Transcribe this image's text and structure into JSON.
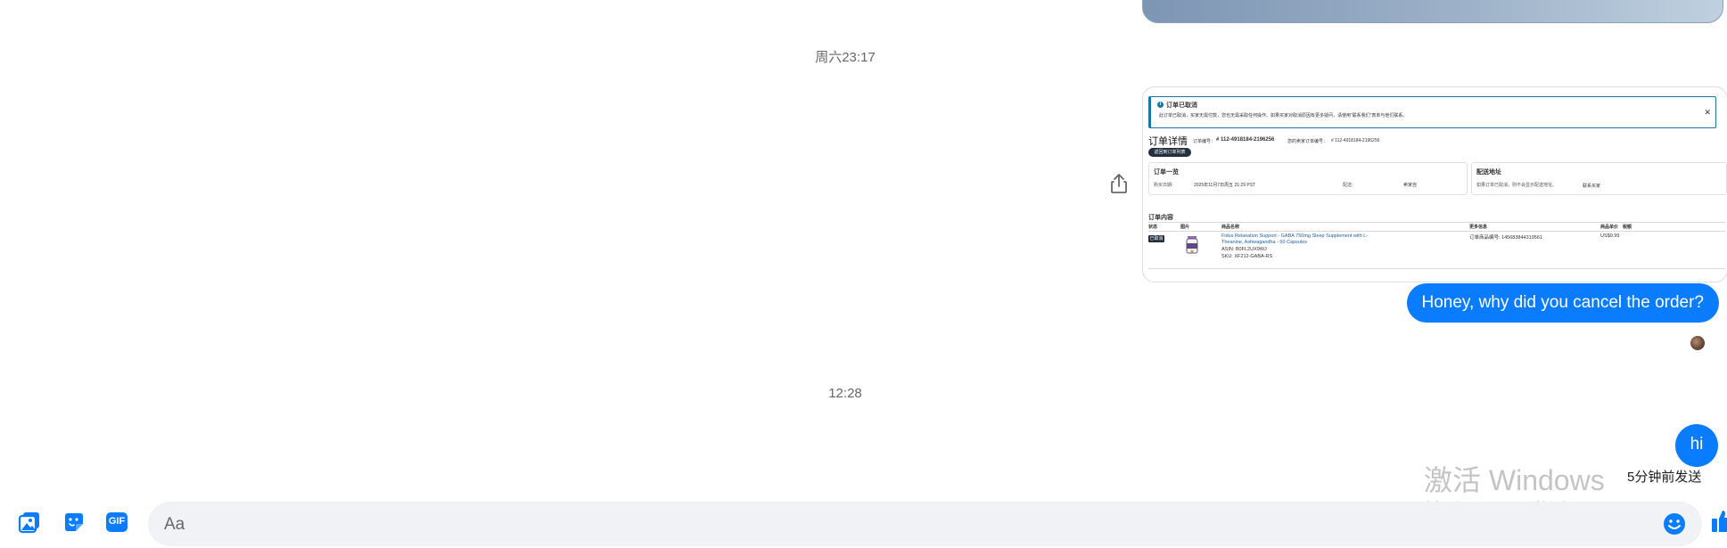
{
  "thread": {
    "timestamp_1": "周六23:17",
    "timestamp_2": "12:28"
  },
  "order_screenshot": {
    "alert_title": "订单已取消",
    "alert_body": "此订单已取消，买家无需付款，您也无需采取任何操作。如果买家对取消原因有更多疑问，请使用“联系我们”表单与他们联系。",
    "heading": "订单详情",
    "order_id_label": "订单编号：",
    "order_id": "# 112-4918184-2196256",
    "seller_order_label": "您的卖家订单编号：",
    "seller_order_id": "# 112-4918184-2196256",
    "back_button": "返回到订单列表",
    "summary_title": "订单一览",
    "ship_date_label": "购买日期:",
    "ship_date": "2025年11月7日周五 21:29 PST",
    "channel_label": "配送:",
    "channel": "卖家自",
    "address_title": "配送地址",
    "address_note": "如果订单已取消，则不会显示配送地址。",
    "address_link": "联系买家",
    "contents_title": "订单内容",
    "columns": [
      "状态",
      "图片",
      "商品名称",
      "更多信息",
      "商品单价",
      "税额"
    ],
    "row": {
      "status": "已取消",
      "product_line1": "Fidus Relaxation Support - GABA 750mg Sleep Supplement with L-",
      "product_line2": "Theanine, Ashwagandha - 60 Capsules",
      "asin": "ASIN: B0FL2UX9WJ",
      "sku": "SKU: XF212-GABA-RS",
      "more_info": "订单商品编号: 145683844319561",
      "unit_price": "US$9.99"
    }
  },
  "messages": {
    "question": "Honey, why did you cancel the order?",
    "hi": "hi",
    "sent_status": "5分钟前发送"
  },
  "watermark": {
    "title": "激活 Windows",
    "subtitle": "转到“设置”以激活 Windows。"
  },
  "composer": {
    "placeholder": "Aa",
    "gif_label": "GIF"
  },
  "icons": [
    "share-icon",
    "photo-icon",
    "sticker-icon",
    "gif-icon",
    "emoji-icon",
    "like-icon"
  ],
  "colors": {
    "accent": "#0a7cff",
    "composer_bg": "#f0f2f5",
    "timestamp": "#65676b"
  }
}
